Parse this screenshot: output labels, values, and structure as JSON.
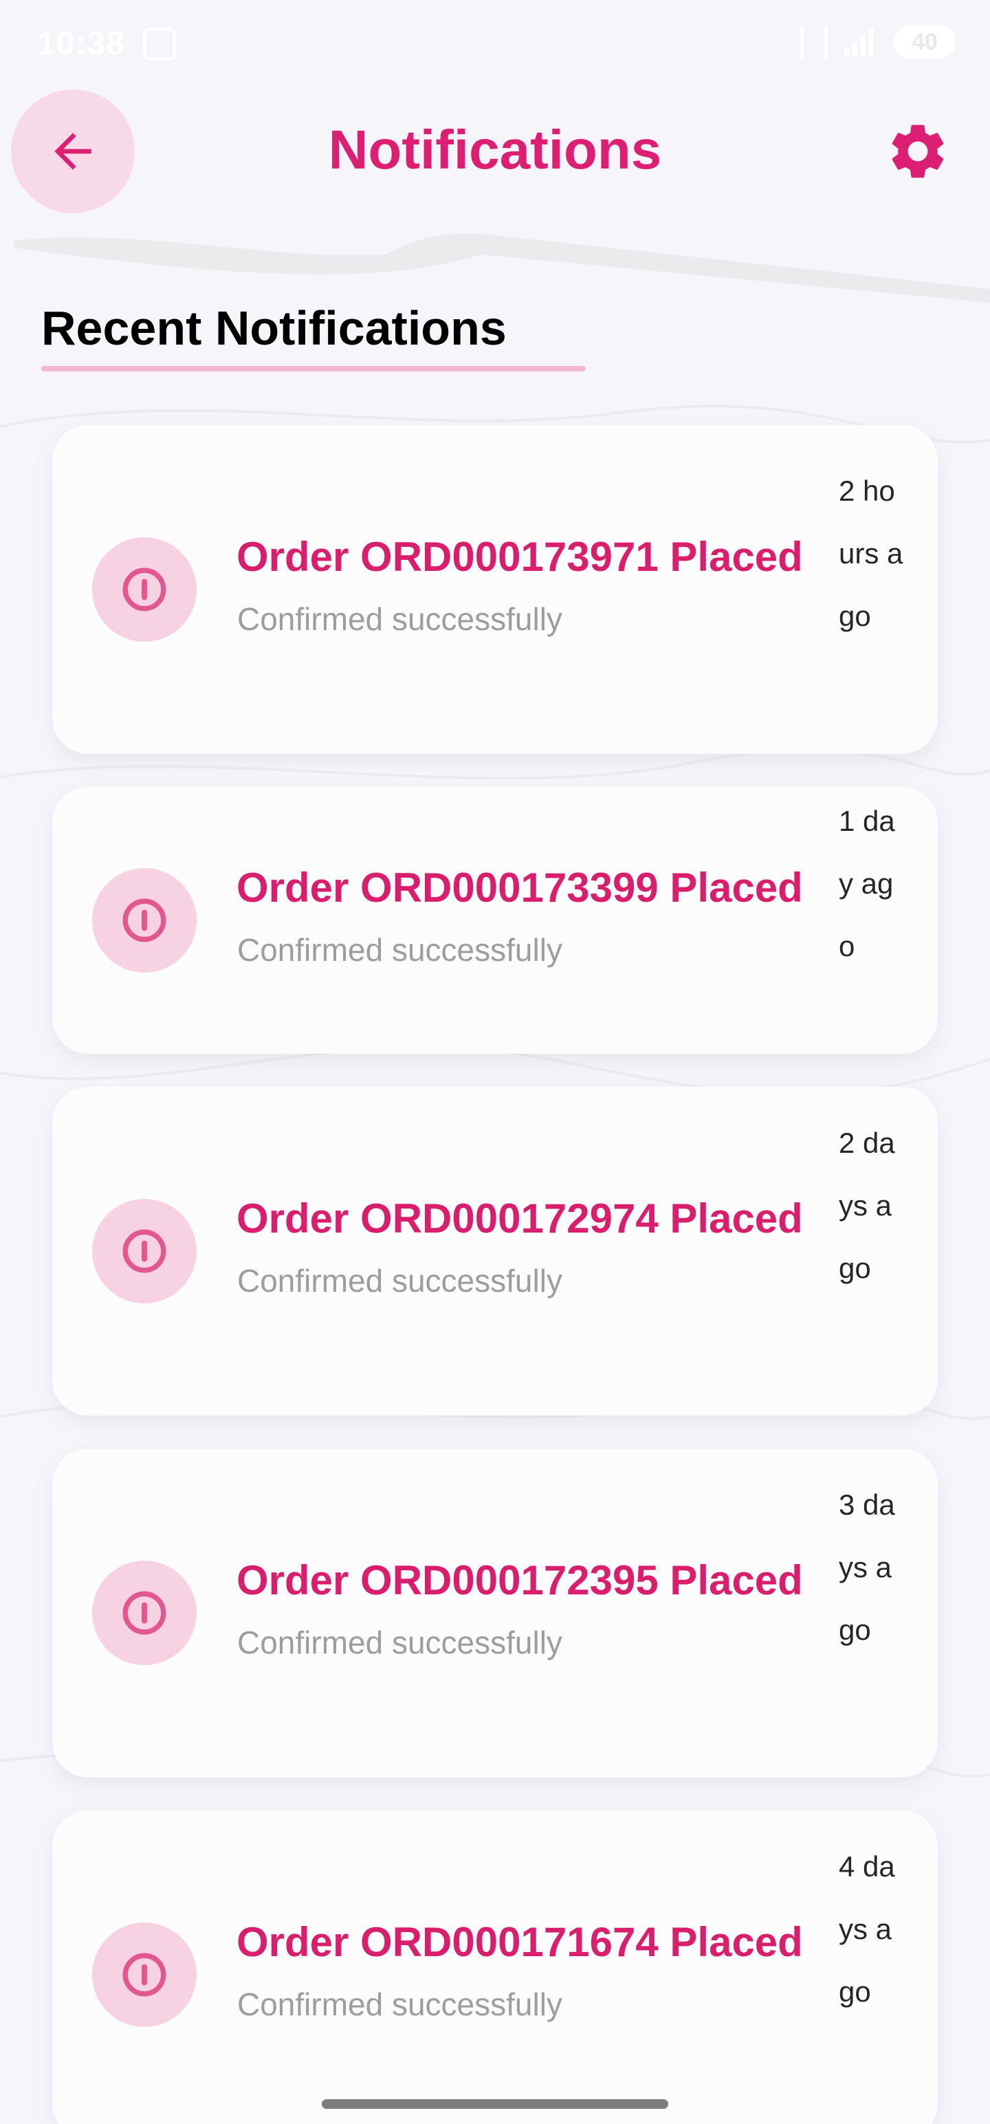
{
  "status_bar": {
    "time": "10:38",
    "battery": "40"
  },
  "header": {
    "title": "Notifications",
    "back_icon": "arrow-left-icon",
    "settings_icon": "gear-icon"
  },
  "section": {
    "title": "Recent Notifications"
  },
  "notifications": [
    {
      "title": "Order ORD000173971 Placed",
      "subtitle": "Confirmed successfully",
      "time": "2 hours ago",
      "icon": "info-icon"
    },
    {
      "title": "Order ORD000173399 Placed",
      "subtitle": "Confirmed successfully",
      "time": "1 day ago",
      "icon": "info-icon"
    },
    {
      "title": "Order ORD000172974 Placed",
      "subtitle": "Confirmed successfully",
      "time": "2 days ago",
      "icon": "info-icon"
    },
    {
      "title": "Order ORD000172395 Placed",
      "subtitle": "Confirmed successfully",
      "time": "3 days ago",
      "icon": "info-icon"
    },
    {
      "title": "Order ORD000171674 Placed",
      "subtitle": "Confirmed successfully",
      "time": "4 days ago",
      "icon": "info-icon"
    }
  ],
  "colors": {
    "accent": "#dd1f73",
    "accent_soft": "#f7d9e8",
    "background": "#f6f5fa",
    "card": "#fcfcfd",
    "subtitle": "#9d9d9d"
  }
}
